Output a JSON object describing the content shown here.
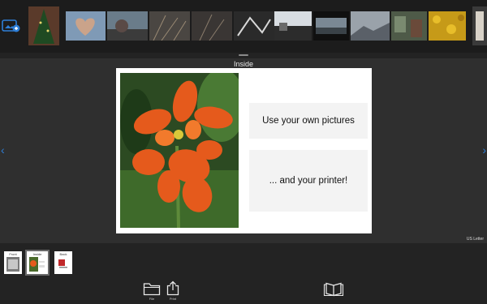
{
  "page": {
    "title": "Inside",
    "paper_size": "US Letter"
  },
  "card": {
    "line1": "Use your own pictures",
    "line2": "... and your printer!"
  },
  "pages": [
    {
      "label": "Front"
    },
    {
      "label": "Inside"
    },
    {
      "label": "Back"
    }
  ],
  "toolbar": {
    "file_label": "File",
    "print_label": "Print"
  },
  "icons": {
    "photos": "photo-library-icon",
    "folder": "folder-icon",
    "share": "share-icon",
    "book": "open-book-icon",
    "prev": "chevron-left-icon",
    "next": "chevron-right-icon"
  },
  "colors": {
    "accent": "#2e7fd8",
    "background": "#232323"
  }
}
